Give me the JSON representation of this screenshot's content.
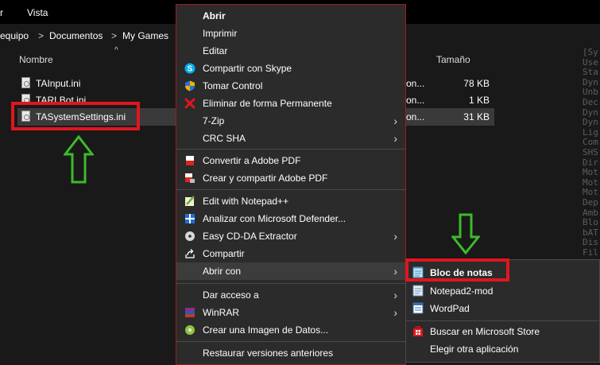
{
  "menubar": {
    "items": [
      "r",
      "Vista"
    ]
  },
  "breadcrumb": {
    "items": [
      "equipo",
      "Documentos",
      "My Games"
    ],
    "separator": ">"
  },
  "columns": {
    "name": "Nombre",
    "size": "Tamaño"
  },
  "files": [
    {
      "name": "TAInput.ini",
      "type": "on...",
      "size": "78 KB"
    },
    {
      "name": "TARLBot.ini",
      "type": "on...",
      "size": "1 KB"
    },
    {
      "name": "TASystemSettings.ini",
      "type": "on...",
      "size": "31 KB"
    }
  ],
  "context_menu": {
    "items": [
      {
        "label": "Abrir",
        "icon": "none",
        "bold": true
      },
      {
        "label": "Imprimir",
        "icon": "none"
      },
      {
        "label": "Editar",
        "icon": "none"
      },
      {
        "label": "Compartir con Skype",
        "icon": "skype-icon"
      },
      {
        "label": "Tomar Control",
        "icon": "shield-icon"
      },
      {
        "label": "Eliminar de forma Permanente",
        "icon": "red-x-icon"
      },
      {
        "label": "7-Zip",
        "icon": "none",
        "submenu": true
      },
      {
        "label": "CRC SHA",
        "icon": "none",
        "submenu": true
      },
      {
        "label": "Convertir a Adobe PDF",
        "icon": "pdf-icon"
      },
      {
        "label": "Crear y compartir Adobe PDF",
        "icon": "pdf-share-icon"
      },
      {
        "label": "Edit with Notepad++",
        "icon": "notepadpp-icon"
      },
      {
        "label": "Analizar con Microsoft Defender...",
        "icon": "defender-icon"
      },
      {
        "label": "Easy CD-DA Extractor",
        "icon": "cd-icon",
        "submenu": true
      },
      {
        "label": "Compartir",
        "icon": "share-icon"
      },
      {
        "label": "Abrir con",
        "icon": "none",
        "submenu": true,
        "active": true
      },
      {
        "label": "Dar acceso a",
        "icon": "none",
        "submenu": true
      },
      {
        "label": "WinRAR",
        "icon": "winrar-icon",
        "submenu": true
      },
      {
        "label": "Crear una Imagen de Datos...",
        "icon": "disc-image-icon"
      },
      {
        "label": "Restaurar versiones anteriores",
        "icon": "none"
      }
    ]
  },
  "open_with_submenu": {
    "items": [
      {
        "label": "Bloc de notas",
        "icon": "notepad-icon",
        "bold": true
      },
      {
        "label": "Notepad2-mod",
        "icon": "notepad2-icon"
      },
      {
        "label": "WordPad",
        "icon": "wordpad-icon"
      },
      {
        "label": "Buscar en Microsoft Store",
        "icon": "store-icon"
      },
      {
        "label": "Elegir otra aplicación",
        "icon": "none"
      }
    ]
  },
  "background_text": [
    "[Sy",
    "Use",
    "Sta",
    "Dyn",
    "Unb",
    "Dec",
    "Dyn",
    "Dyn",
    "Lig",
    "Com",
    "SHS",
    "Dir",
    "Mot",
    "Mot",
    "Mot",
    "Dep",
    "Amb",
    "Blo",
    "bAT",
    "Dis",
    "Fil"
  ],
  "colors": {
    "highlight_red": "#e0161f",
    "arrow_green": "#3dba2b",
    "menu_bg": "#2b2b2b",
    "window_bg": "#191919"
  }
}
